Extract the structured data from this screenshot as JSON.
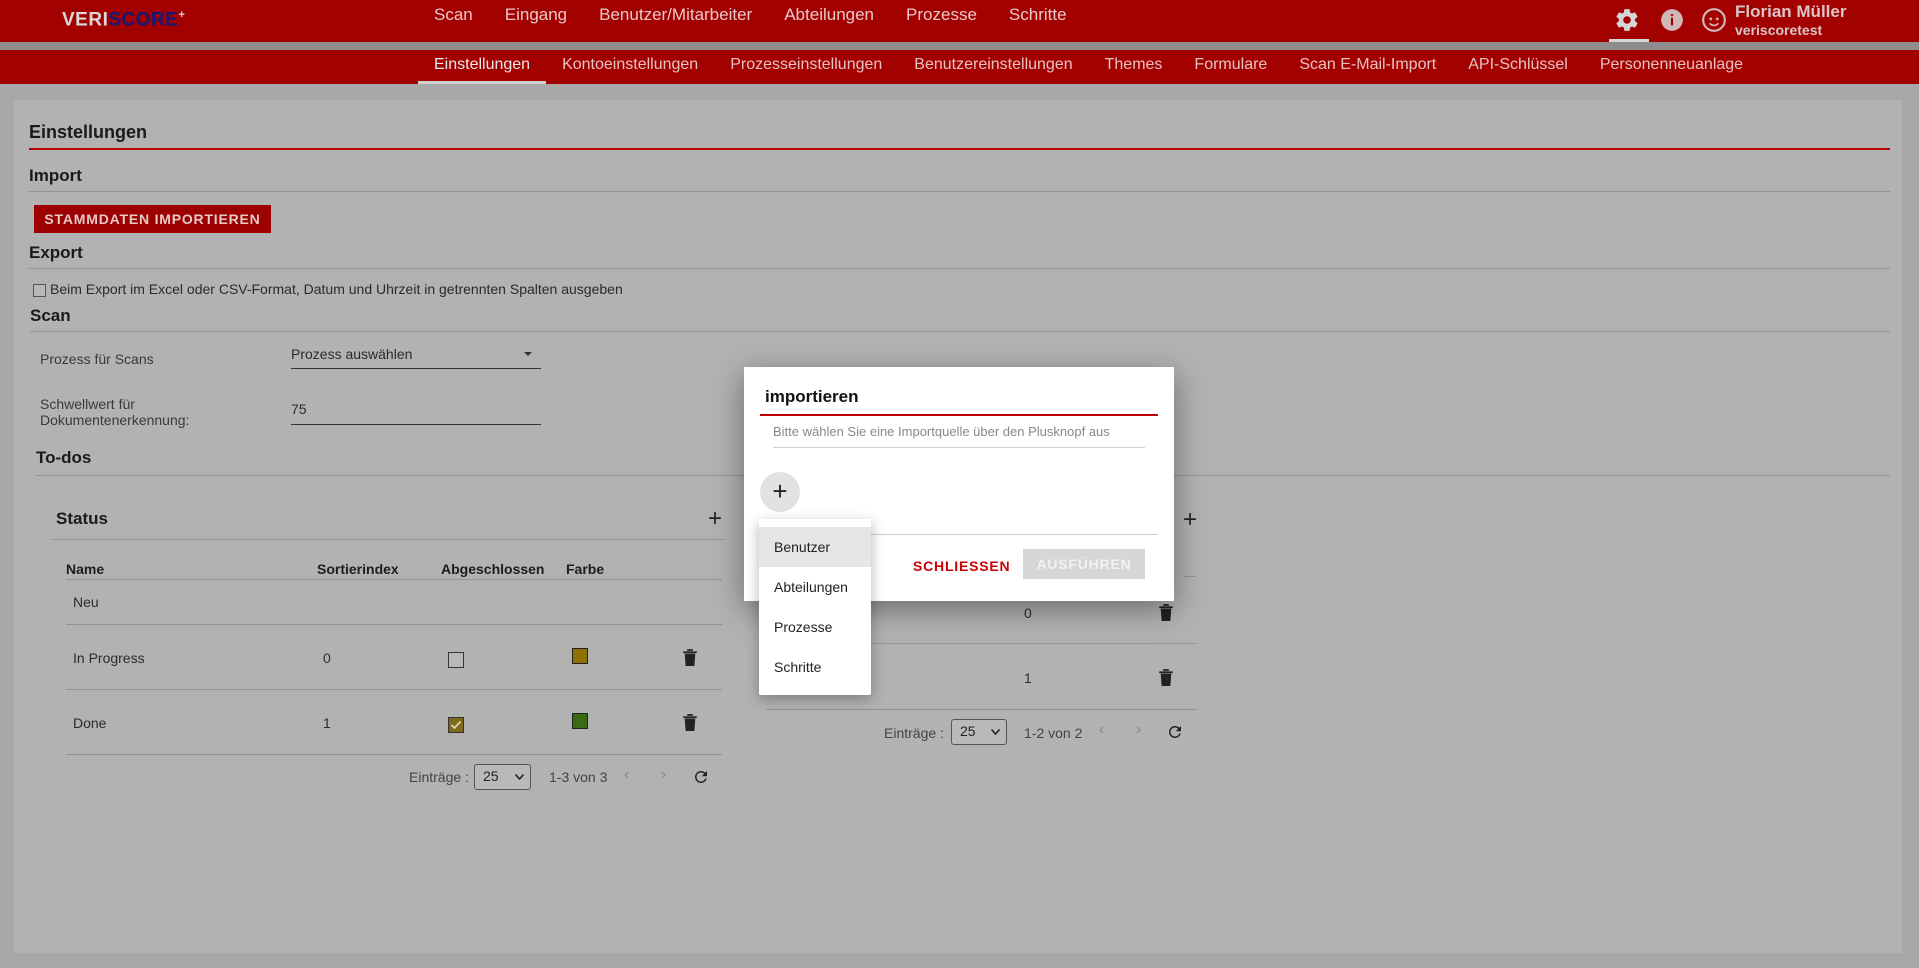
{
  "app": {
    "logo": {
      "prefix": "VERI",
      "accent": "SCORE",
      "mark": "+"
    },
    "main_nav": [
      "Scan",
      "Eingang",
      "Benutzer/Mitarbeiter",
      "Abteilungen",
      "Prozesse",
      "Schritte"
    ],
    "icons": {
      "settings": "gear-icon",
      "info": "info-icon",
      "user": "account-icon"
    },
    "user": {
      "name": "Florian Müller",
      "account": "veriscoretest"
    },
    "sub_nav": [
      "Einstellungen",
      "Kontoeinstellungen",
      "Prozesseinstellungen",
      "Benutzereinstellungen",
      "Themes",
      "Formulare",
      "Scan E-Mail-Import",
      "API-Schlüssel",
      "Personenneuanlage"
    ],
    "sub_nav_active": "Einstellungen",
    "colors": {
      "brand": "#a30000",
      "accent_red": "#c00000"
    }
  },
  "page": {
    "title": "Einstellungen",
    "import": {
      "heading": "Import",
      "button": "STAMMDATEN IMPORTIEREN"
    },
    "export": {
      "heading": "Export",
      "checkbox_label": "Beim Export im Excel oder CSV-Format, Datum und Uhrzeit in getrennten Spalten ausgeben",
      "checked": false
    },
    "scan": {
      "heading": "Scan",
      "process_label": "Prozess für Scans",
      "process_value": "Prozess auswählen",
      "threshold_label_line1": "Schwellwert für",
      "threshold_label_line2": "Dokumentenerkennung:",
      "threshold_value": "75"
    },
    "todos": {
      "heading": "To-dos"
    },
    "status_table": {
      "title": "Status",
      "columns": [
        "Name",
        "Sortierindex",
        "Abgeschlossen",
        "Farbe"
      ],
      "rows": [
        {
          "name": "Neu",
          "sort": "",
          "done": null,
          "color": null
        },
        {
          "name": "In Progress",
          "sort": "0",
          "done": false,
          "color": "#8f7000"
        },
        {
          "name": "Done",
          "sort": "1",
          "done": true,
          "color": "#3b6b14"
        }
      ],
      "pager": {
        "label": "Einträge :",
        "page_size": "25",
        "range": "1-3 von 3"
      }
    },
    "second_table": {
      "rows": [
        {
          "sort": "0"
        },
        {
          "sort": "1"
        }
      ],
      "pager": {
        "label": "Einträge :",
        "page_size": "25",
        "range": "1-2 von 2"
      }
    }
  },
  "dialog": {
    "title": "importieren",
    "hint": "Bitte wählen Sie eine Importquelle über den Plusknopf aus",
    "add_symbol": "+",
    "close_label": "SCHLIESSEN",
    "run_label": "AUSFÜHREN",
    "menu": [
      "Benutzer",
      "Abteilungen",
      "Prozesse",
      "Schritte"
    ],
    "menu_highlighted": "Benutzer"
  }
}
